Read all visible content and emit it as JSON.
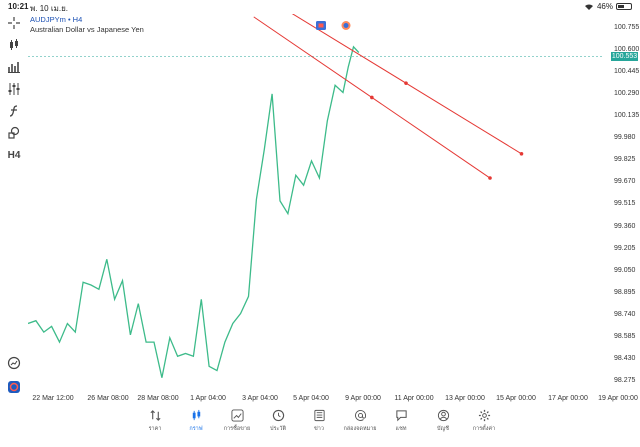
{
  "status": {
    "time": "10:21",
    "date": "พ. 10 เม.ย.",
    "battery": "46%",
    "battery_level": 0.46
  },
  "symbol": {
    "name": "AUDJPYm",
    "separator": "•",
    "timeframe": "H4",
    "description": "Australian Dollar vs Japanese Yen"
  },
  "toolbar": {
    "timeframe_label": "H4"
  },
  "colors": {
    "line": "#3dbb8a",
    "trend_line": "#e53935",
    "current_price_bg": "#26a69a",
    "active_nav": "#1a73e8"
  },
  "price_axis": {
    "ticks": [
      "100.755",
      "100.600",
      "100.445",
      "100.290",
      "100.135",
      "99.980",
      "99.825",
      "99.670",
      "99.515",
      "99.360",
      "99.205",
      "99.050",
      "98.895",
      "98.740",
      "98.585",
      "98.430",
      "98.275"
    ],
    "current": "100.553"
  },
  "time_axis": {
    "ticks": [
      "22 Mar 12:00",
      "26 Mar 08:00",
      "28 Mar 08:00",
      "1 Apr 04:00",
      "3 Apr 04:00",
      "5 Apr 04:00",
      "9 Apr 00:00",
      "11 Apr 00:00",
      "13 Apr 00:00",
      "15 Apr 00:00",
      "17 Apr 00:00",
      "19 Apr 00:00"
    ]
  },
  "chart_data": {
    "type": "line",
    "symbol": "AUDJPYm",
    "timeframe": "H4",
    "ylim": [
      98.2,
      100.85
    ],
    "current_price": 100.553,
    "x_tick_labels": [
      "22 Mar 12:00",
      "26 Mar 08:00",
      "28 Mar 08:00",
      "1 Apr 04:00",
      "3 Apr 04:00",
      "5 Apr 04:00",
      "9 Apr 00:00",
      "11 Apr 00:00",
      "13 Apr 00:00",
      "15 Apr 00:00",
      "17 Apr 00:00",
      "19 Apr 00:00"
    ],
    "y_tick_labels": [
      "100.755",
      "100.600",
      "100.445",
      "100.290",
      "100.135",
      "99.980",
      "99.825",
      "99.670",
      "99.515",
      "99.360",
      "99.205",
      "99.050",
      "98.895",
      "98.740",
      "98.585",
      "98.430",
      "98.275"
    ],
    "series": [
      {
        "x_index": [
          0,
          0.15,
          0.3,
          0.45,
          0.6,
          0.75,
          0.9,
          1.05,
          1.2,
          1.35,
          1.5,
          1.65,
          1.8,
          1.95,
          2.1,
          2.25,
          2.4,
          2.55,
          2.7,
          2.85,
          3.0,
          3.15,
          3.3,
          3.45,
          3.6,
          3.75,
          3.9,
          4.05,
          4.2,
          4.35,
          4.5,
          4.65,
          4.8,
          4.95,
          5.1,
          5.25,
          5.4,
          5.55,
          5.7,
          5.85,
          6.0,
          6.1,
          6.2,
          6.3
        ],
        "values": [
          98.68,
          98.7,
          98.62,
          98.66,
          98.55,
          98.68,
          98.62,
          98.97,
          98.95,
          98.92,
          99.13,
          98.85,
          98.98,
          98.6,
          98.82,
          98.55,
          98.55,
          98.3,
          98.58,
          98.45,
          98.47,
          98.45,
          98.85,
          98.38,
          98.35,
          98.55,
          98.68,
          98.75,
          98.87,
          99.55,
          99.9,
          100.29,
          99.54,
          99.45,
          99.72,
          99.65,
          99.82,
          99.7,
          100.1,
          100.35,
          100.3,
          100.48,
          100.62,
          100.58
        ]
      }
    ],
    "trend_lines": [
      {
        "from": {
          "x": 4.3,
          "y": 100.83
        },
        "to": {
          "x": 8.8,
          "y": 99.7
        }
      },
      {
        "from": {
          "x": 5.0,
          "y": 100.86
        },
        "to": {
          "x": 9.4,
          "y": 99.87
        }
      }
    ]
  },
  "nav": {
    "items": [
      {
        "label": "ราคา",
        "icon": "arrows-updown-icon"
      },
      {
        "label": "กราฟ",
        "icon": "candles-icon"
      },
      {
        "label": "การซื้อขาย",
        "icon": "trend-icon"
      },
      {
        "label": "ประวัติ",
        "icon": "history-icon"
      },
      {
        "label": "ข่าว",
        "icon": "news-icon"
      },
      {
        "label": "กล่องจดหมาย",
        "icon": "at-icon"
      },
      {
        "label": "แชท",
        "icon": "chat-icon"
      },
      {
        "label": "บัญชี",
        "icon": "account-icon"
      },
      {
        "label": "การตั้งค่า",
        "icon": "gear-icon"
      }
    ],
    "active_index": 1
  }
}
